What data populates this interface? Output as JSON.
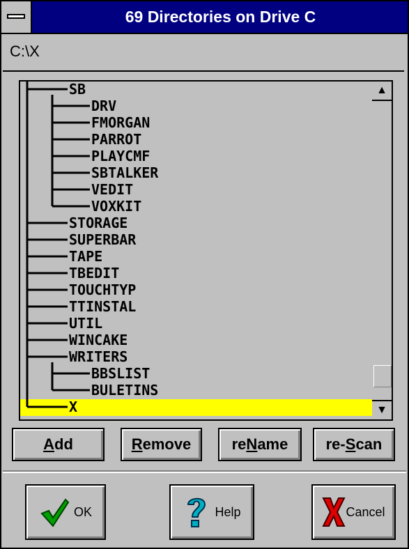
{
  "window": {
    "title": "69 Directories on Drive C"
  },
  "path": {
    "value": "C:\\X"
  },
  "tree": {
    "items": [
      {
        "name": "SB",
        "depth": 1
      },
      {
        "name": "DRV",
        "depth": 2
      },
      {
        "name": "FMORGAN",
        "depth": 2
      },
      {
        "name": "PARROT",
        "depth": 2
      },
      {
        "name": "PLAYCMF",
        "depth": 2
      },
      {
        "name": "SBTALKER",
        "depth": 2
      },
      {
        "name": "VEDIT",
        "depth": 2
      },
      {
        "name": "VOXKIT",
        "depth": 2
      },
      {
        "name": "STORAGE",
        "depth": 1
      },
      {
        "name": "SUPERBAR",
        "depth": 1
      },
      {
        "name": "TAPE",
        "depth": 1
      },
      {
        "name": "TBEDIT",
        "depth": 1
      },
      {
        "name": "TOUCHTYP",
        "depth": 1
      },
      {
        "name": "TTINSTAL",
        "depth": 1
      },
      {
        "name": "UTIL",
        "depth": 1
      },
      {
        "name": "WINCAKE",
        "depth": 1
      },
      {
        "name": "WRITERS",
        "depth": 1
      },
      {
        "name": "BBSLIST",
        "depth": 2
      },
      {
        "name": "BULETINS",
        "depth": 2
      },
      {
        "name": "X",
        "depth": 1,
        "selected": true
      }
    ],
    "selected_color": "#ffff00"
  },
  "scrollbar": {
    "up_icon": "arrow-up-icon",
    "down_icon": "arrow-down-icon",
    "position": 0.95
  },
  "actions": {
    "add": {
      "pre": "",
      "key": "A",
      "post": "dd"
    },
    "remove": {
      "pre": "",
      "key": "R",
      "post": "emove"
    },
    "rename": {
      "pre": "re",
      "key": "N",
      "post": "ame"
    },
    "rescan": {
      "pre": "re-",
      "key": "S",
      "post": "can"
    }
  },
  "dialog_buttons": {
    "ok": {
      "label": "OK",
      "icon": "checkmark-icon",
      "color": "#00a000"
    },
    "help": {
      "label": "Help",
      "icon": "question-mark-icon",
      "color": "#00b0c0"
    },
    "cancel": {
      "label": "Cancel",
      "icon": "red-x-icon",
      "color": "#e00000"
    }
  }
}
